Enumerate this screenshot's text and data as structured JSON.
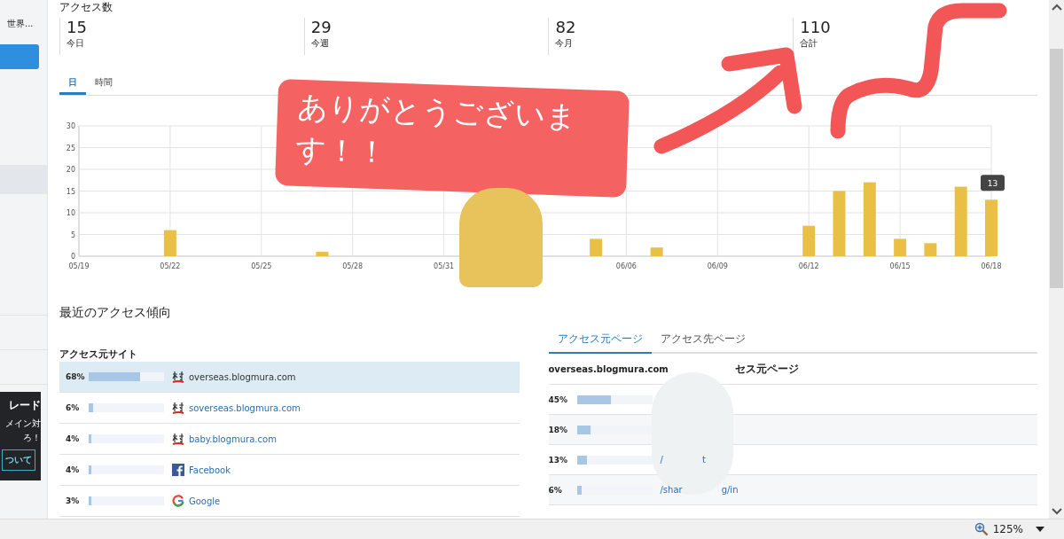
{
  "sidebar": {
    "item_label": "世界...",
    "promo": {
      "title": "レード",
      "lines": [
        "メイン対",
        "ろ！"
      ],
      "button": "ついて"
    }
  },
  "section_title": "アクセス数",
  "stats": [
    {
      "value": "15",
      "label": "今日"
    },
    {
      "value": "29",
      "label": "今週"
    },
    {
      "value": "82",
      "label": "今月"
    },
    {
      "value": "110",
      "label": "合計"
    }
  ],
  "period_tabs": [
    {
      "label": "日",
      "selected": true
    },
    {
      "label": "時間",
      "selected": false
    }
  ],
  "chart": {
    "tooltip": "13",
    "chart_data": {
      "type": "bar",
      "grid": true,
      "categories": [
        "05/19",
        null,
        null,
        "05/22",
        null,
        null,
        "05/25",
        null,
        null,
        "05/28",
        null,
        null,
        "05/31",
        null,
        null,
        null,
        null,
        null,
        "06/06",
        null,
        null,
        "06/09",
        null,
        null,
        "06/12",
        null,
        null,
        "06/15",
        null,
        null,
        "06/18"
      ],
      "series": [
        {
          "color": "#e9c046",
          "values": [
            0,
            0,
            0,
            6,
            0,
            0,
            0,
            0,
            1,
            0,
            0,
            0,
            0,
            null,
            null,
            null,
            0,
            4,
            0,
            2,
            0,
            0,
            0,
            0,
            7,
            15,
            17,
            4,
            3,
            16,
            13
          ]
        }
      ],
      "ylim": [
        0,
        30
      ],
      "yticks": [
        0,
        5,
        10,
        15,
        20,
        25,
        30
      ]
    }
  },
  "bubble": {
    "text": "ありがとうございます！！"
  },
  "trends": {
    "title": "最近のアクセス傾向",
    "sites": {
      "title": "アクセス元サイト",
      "rows": [
        {
          "share": "68%",
          "level": 0.68,
          "kind": "blogmura",
          "site": "overseas.blogmura.com",
          "selected": true
        },
        {
          "share": "6%",
          "level": 0.06,
          "kind": "blogmura",
          "site": "soverseas.blogmura.com",
          "selected": false
        },
        {
          "share": "4%",
          "level": 0.04,
          "kind": "blogmura",
          "site": "baby.blogmura.com",
          "selected": false
        },
        {
          "share": "4%",
          "level": 0.04,
          "kind": "facebook",
          "site": "Facebook",
          "selected": false
        },
        {
          "share": "3%",
          "level": 0.03,
          "kind": "google",
          "site": "Google",
          "selected": false
        }
      ]
    },
    "pages": {
      "tabs": [
        {
          "label": "アクセス元ページ",
          "selected": true
        },
        {
          "label": "アクセス先ページ",
          "selected": false
        }
      ],
      "heading_left": "overseas.blogmura.com",
      "heading_right": "セス元ページ",
      "rows": [
        {
          "share": "45%",
          "level": 0.45,
          "fragments": []
        },
        {
          "share": "18%",
          "level": 0.18,
          "fragments": []
        },
        {
          "share": "13%",
          "level": 0.13,
          "fragments": [
            "/",
            "t"
          ]
        },
        {
          "share": "6%",
          "level": 0.06,
          "fragments": [
            "/shar",
            "g/in"
          ]
        }
      ]
    }
  },
  "status_bar": {
    "zoom": "125%"
  }
}
